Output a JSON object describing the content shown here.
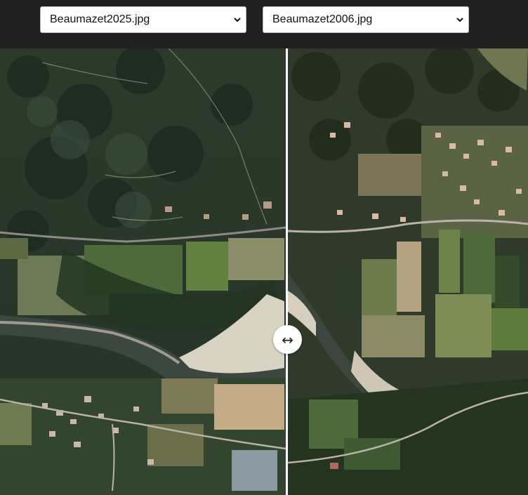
{
  "toolbar": {
    "left_select": {
      "value": "Beaumazet2025.jpg"
    },
    "right_select": {
      "value": "Beaumazet2006.jpg"
    }
  },
  "viewer": {
    "left_image": {
      "icon": "aerial-photo-2025"
    },
    "right_image": {
      "icon": "aerial-photo-2006"
    },
    "handle": {
      "icon": "left-right-arrow-icon",
      "glyph": "↔"
    },
    "split_position_percent": 54.5
  },
  "colors": {
    "toolbar_bg": "#202020",
    "divider": "#ffffff"
  }
}
